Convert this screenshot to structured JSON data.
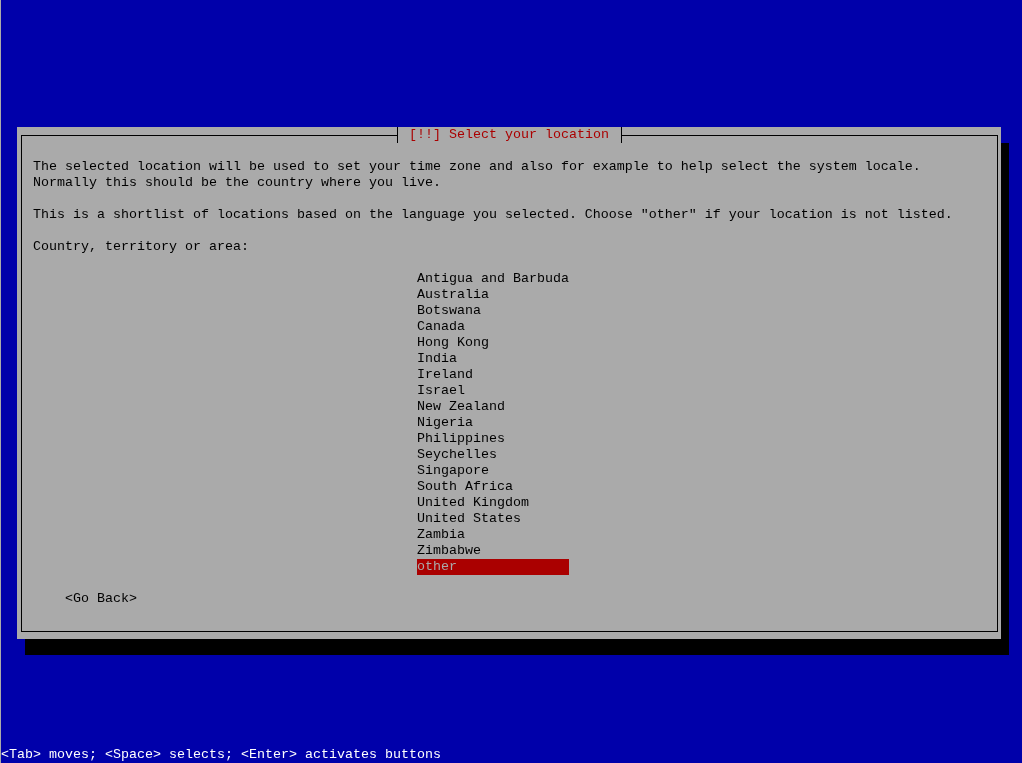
{
  "dialog": {
    "title": "[!!] Select your location",
    "paragraphs": [
      "The selected location will be used to set your time zone and also for example to help select the system locale.\nNormally this should be the country where you live.",
      "This is a shortlist of locations based on the language you selected. Choose \"other\" if your location is not listed."
    ],
    "list_label": "Country, territory or area:",
    "options": [
      {
        "label": "Antigua and Barbuda",
        "selected": false
      },
      {
        "label": "Australia",
        "selected": false
      },
      {
        "label": "Botswana",
        "selected": false
      },
      {
        "label": "Canada",
        "selected": false
      },
      {
        "label": "Hong Kong",
        "selected": false
      },
      {
        "label": "India",
        "selected": false
      },
      {
        "label": "Ireland",
        "selected": false
      },
      {
        "label": "Israel",
        "selected": false
      },
      {
        "label": "New Zealand",
        "selected": false
      },
      {
        "label": "Nigeria",
        "selected": false
      },
      {
        "label": "Philippines",
        "selected": false
      },
      {
        "label": "Seychelles",
        "selected": false
      },
      {
        "label": "Singapore",
        "selected": false
      },
      {
        "label": "South Africa",
        "selected": false
      },
      {
        "label": "United Kingdom",
        "selected": false
      },
      {
        "label": "United States",
        "selected": false
      },
      {
        "label": "Zambia",
        "selected": false
      },
      {
        "label": "Zimbabwe",
        "selected": false
      },
      {
        "label": "other",
        "selected": true
      }
    ],
    "buttons": [
      {
        "label": "<Go Back>"
      }
    ]
  },
  "help_line": "<Tab> moves; <Space> selects; <Enter> activates buttons"
}
